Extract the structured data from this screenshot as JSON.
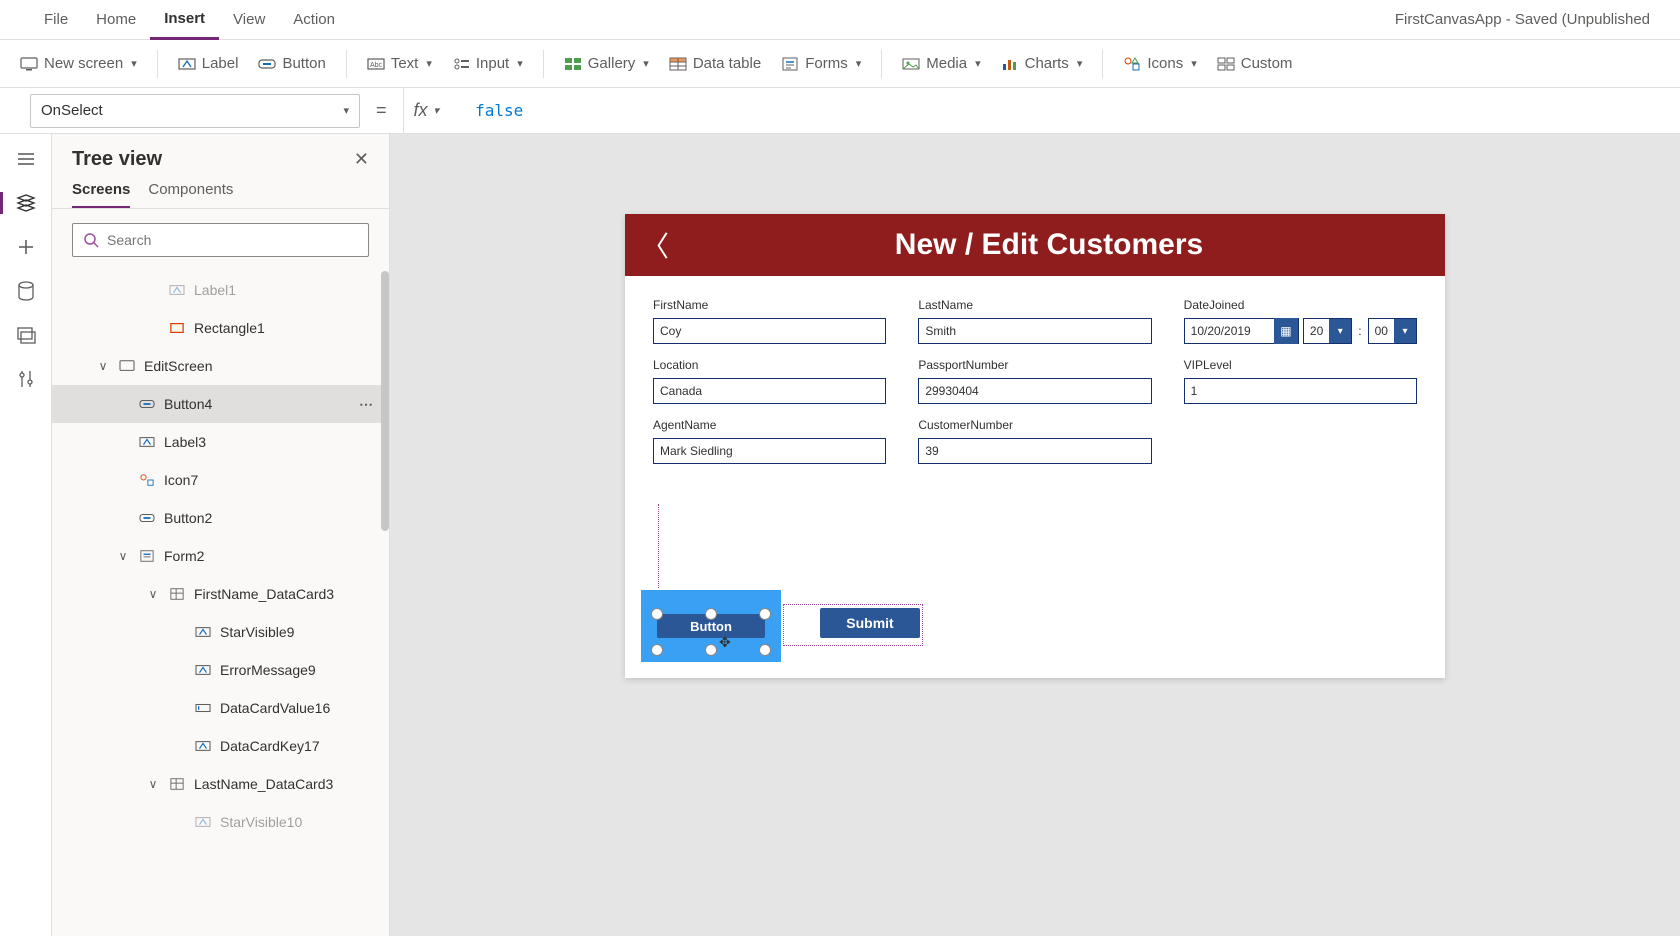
{
  "menubar": {
    "items": [
      "File",
      "Home",
      "Insert",
      "View",
      "Action"
    ],
    "active_index": 2,
    "app_title": "FirstCanvasApp - Saved (Unpublished"
  },
  "ribbon": {
    "new_screen": "New screen",
    "label": "Label",
    "button": "Button",
    "text": "Text",
    "input": "Input",
    "gallery": "Gallery",
    "data_table": "Data table",
    "forms": "Forms",
    "media": "Media",
    "charts": "Charts",
    "icons": "Icons",
    "custom": "Custom"
  },
  "formulabar": {
    "property": "OnSelect",
    "fx": "fx",
    "value": "false"
  },
  "treeview": {
    "title": "Tree view",
    "tabs": [
      "Screens",
      "Components"
    ],
    "active_tab": 0,
    "search_placeholder": "Search",
    "items": [
      {
        "label": "Label1",
        "indent": 2,
        "icon": "label",
        "chevron": "",
        "faded": true
      },
      {
        "label": "Rectangle1",
        "indent": 2,
        "icon": "rectangle",
        "chevron": ""
      },
      {
        "label": "EditScreen",
        "indent": 0,
        "icon": "screen",
        "chevron": "∨"
      },
      {
        "label": "Button4",
        "indent": 1,
        "icon": "button",
        "chevron": "",
        "selected": true,
        "more": "⋯"
      },
      {
        "label": "Label3",
        "indent": 1,
        "icon": "label",
        "chevron": ""
      },
      {
        "label": "Icon7",
        "indent": 1,
        "icon": "icons",
        "chevron": ""
      },
      {
        "label": "Button2",
        "indent": 1,
        "icon": "button",
        "chevron": ""
      },
      {
        "label": "Form2",
        "indent": 1,
        "icon": "form",
        "chevron": "∨"
      },
      {
        "label": "FirstName_DataCard3",
        "indent": 2,
        "icon": "datacard",
        "chevron": "∨"
      },
      {
        "label": "StarVisible9",
        "indent": 3,
        "icon": "label",
        "chevron": ""
      },
      {
        "label": "ErrorMessage9",
        "indent": 3,
        "icon": "label",
        "chevron": ""
      },
      {
        "label": "DataCardValue16",
        "indent": 3,
        "icon": "textinput",
        "chevron": ""
      },
      {
        "label": "DataCardKey17",
        "indent": 3,
        "icon": "label",
        "chevron": ""
      },
      {
        "label": "LastName_DataCard3",
        "indent": 2,
        "icon": "datacard",
        "chevron": "∨"
      },
      {
        "label": "StarVisible10",
        "indent": 3,
        "icon": "label",
        "chevron": "",
        "faded": true
      }
    ]
  },
  "canvas": {
    "header_title": "New / Edit Customers",
    "fields": {
      "firstname": {
        "label": "FirstName",
        "value": "Coy"
      },
      "lastname": {
        "label": "LastName",
        "value": "Smith"
      },
      "datejoined": {
        "label": "DateJoined",
        "date": "10/20/2019",
        "hour": "20",
        "minute": "00"
      },
      "location": {
        "label": "Location",
        "value": "Canada"
      },
      "passportnumber": {
        "label": "PassportNumber",
        "value": "29930404"
      },
      "viplevel": {
        "label": "VIPLevel",
        "value": "1"
      },
      "agentname": {
        "label": "AgentName",
        "value": "Mark Siedling"
      },
      "customernumber": {
        "label": "CustomerNumber",
        "value": "39"
      }
    },
    "button4_label": "Button",
    "submit_label": "Submit"
  }
}
